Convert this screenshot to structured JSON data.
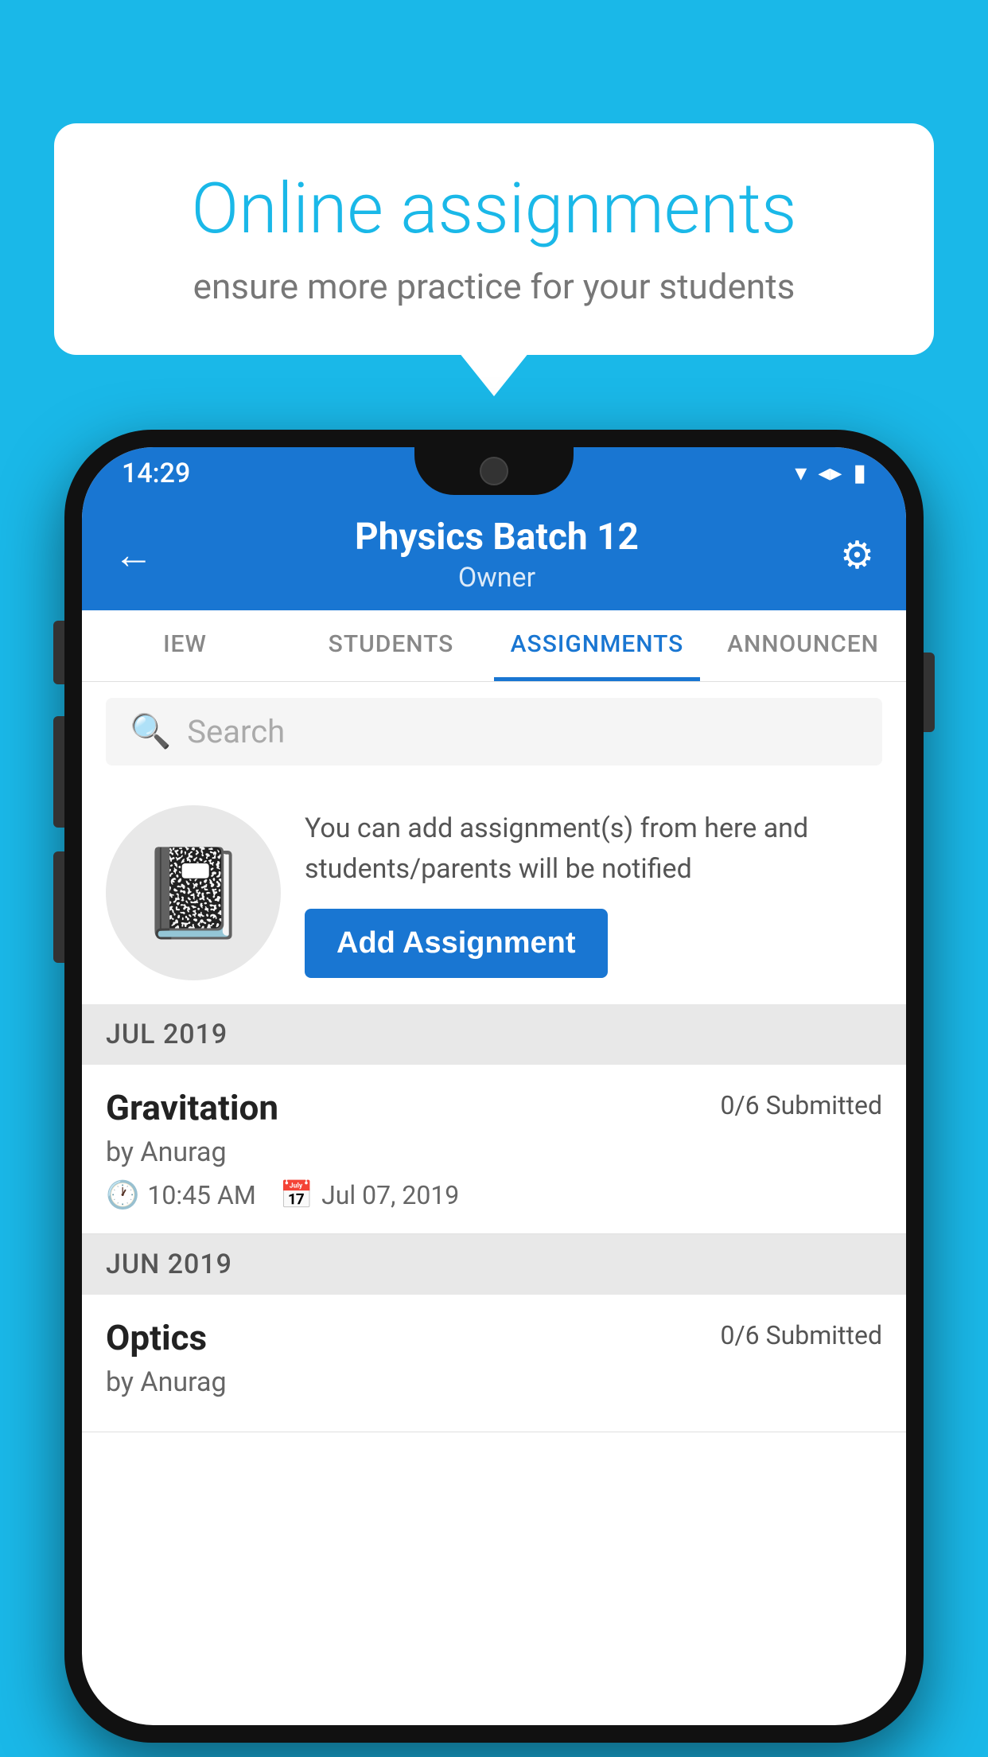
{
  "background_color": "#1ab8e8",
  "speech_bubble": {
    "title": "Online assignments",
    "subtitle": "ensure more practice for your students"
  },
  "phone": {
    "status_bar": {
      "time": "14:29",
      "wifi": "▼",
      "signal": "▲",
      "battery": "▮"
    },
    "header": {
      "title": "Physics Batch 12",
      "subtitle": "Owner",
      "back_label": "←",
      "settings_label": "⚙"
    },
    "tabs": [
      {
        "label": "IEW",
        "active": false
      },
      {
        "label": "STUDENTS",
        "active": false
      },
      {
        "label": "ASSIGNMENTS",
        "active": true
      },
      {
        "label": "ANNOUNCEN",
        "active": false
      }
    ],
    "search": {
      "placeholder": "Search"
    },
    "promo": {
      "text": "You can add assignment(s) from here and students/parents will be notified",
      "button_label": "Add Assignment"
    },
    "sections": [
      {
        "header": "JUL 2019",
        "assignments": [
          {
            "title": "Gravitation",
            "submitted": "0/6 Submitted",
            "author": "by Anurag",
            "time": "10:45 AM",
            "date": "Jul 07, 2019"
          }
        ]
      },
      {
        "header": "JUN 2019",
        "assignments": [
          {
            "title": "Optics",
            "submitted": "0/6 Submitted",
            "author": "by Anurag",
            "time": "",
            "date": ""
          }
        ]
      }
    ]
  }
}
